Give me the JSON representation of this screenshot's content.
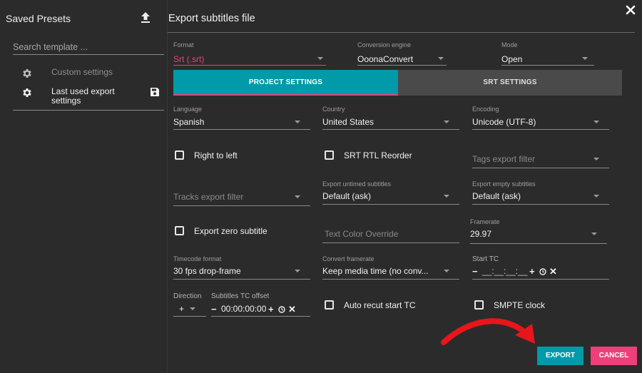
{
  "left_panel": {
    "title": "Saved Presets",
    "search_placeholder": "Search template ...",
    "presets": [
      {
        "label": "Custom settings"
      },
      {
        "label": "Last used export settings"
      }
    ]
  },
  "header": {
    "title": "Export subtitles file"
  },
  "format": {
    "label": "Format",
    "value": "Srt (.srt)"
  },
  "engine": {
    "label": "Conversion engine",
    "value": "OoonaConvert"
  },
  "mode": {
    "label": "Mode",
    "value": "Open"
  },
  "tabs": [
    {
      "label": "PROJECT SETTINGS",
      "active": true
    },
    {
      "label": "SRT SETTINGS",
      "active": false
    }
  ],
  "language": {
    "label": "Language",
    "value": "Spanish"
  },
  "country": {
    "label": "Country",
    "value": "United States"
  },
  "encoding": {
    "label": "Encoding",
    "value": "Unicode (UTF-8)"
  },
  "right_to_left": {
    "label": "Right to left",
    "checked": false
  },
  "srt_rtl_reorder": {
    "label": "SRT RTL Reorder",
    "checked": false
  },
  "tags_export_filter": {
    "placeholder": "Tags export filter"
  },
  "tracks_export_filter": {
    "placeholder": "Tracks export filter"
  },
  "export_untimed": {
    "label": "Export untimed subtitles",
    "value": "Default (ask)"
  },
  "export_empty": {
    "label": "Export empty subtitles",
    "value": "Default (ask)"
  },
  "export_zero": {
    "label": "Export zero subtitle",
    "checked": false
  },
  "text_color_override": {
    "placeholder": "Text Color Override"
  },
  "framerate": {
    "label": "Framerate",
    "value": "29.97"
  },
  "timecode_format": {
    "label": "Timecode format",
    "value": "30 fps drop-frame"
  },
  "convert_framerate": {
    "label": "Convert framerate",
    "value": "Keep media time (no conv..."
  },
  "start_tc": {
    "label": "Start TC",
    "value": "__:__:__:__"
  },
  "direction": {
    "label": "Direction",
    "value": "+"
  },
  "subtitles_tc_offset": {
    "label": "Subtitles TC offset",
    "value": "00:00:00:00"
  },
  "auto_recut": {
    "label": "Auto recut start TC",
    "checked": false
  },
  "smpte_clock": {
    "label": "SMPTE clock",
    "checked": false
  },
  "buttons": {
    "export": "EXPORT",
    "cancel": "CANCEL"
  },
  "colors": {
    "accent_teal": "#009aa8",
    "accent_pink": "#e8457a",
    "background": "#2b2b2b",
    "arrow_red": "#e8151b"
  }
}
